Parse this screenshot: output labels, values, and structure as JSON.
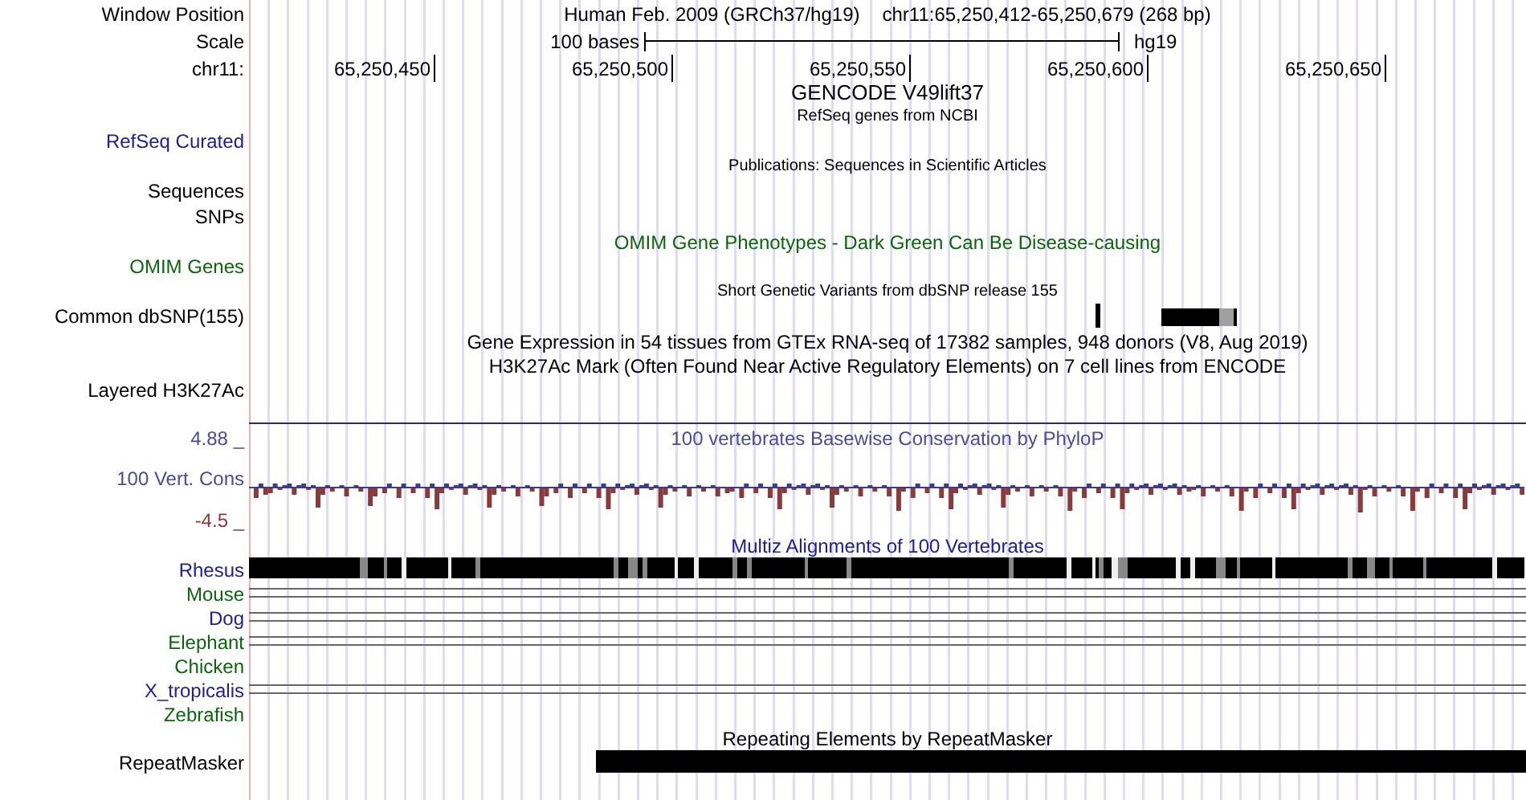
{
  "header": {
    "window_label": "Window Position",
    "scale_label": "Scale",
    "chrom_label": "chr11:",
    "title": "Human Feb. 2009 (GRCh37/hg19)",
    "position": "chr11:65,250,412-65,250,679 (268 bp)",
    "scale_text": "100 bases",
    "scale_db": "hg19",
    "ticks": [
      "65,250,450",
      "65,250,500",
      "65,250,550",
      "65,250,600",
      "65,250,650"
    ]
  },
  "tracks": [
    {
      "kind": "title",
      "title": "GENCODE V49lift37",
      "color": "#000000"
    },
    {
      "kind": "label",
      "title": "RefSeq genes from NCBI",
      "color": "#000000",
      "labels": [
        {
          "text": "RefSeq Curated",
          "color": "#20208f"
        }
      ]
    },
    {
      "kind": "label",
      "title": "Publications: Sequences in Scientific Articles",
      "color": "#000000",
      "labels": [
        {
          "text": "Sequences",
          "color": "#000000"
        },
        {
          "text": "SNPs",
          "color": "#000000"
        }
      ]
    },
    {
      "kind": "label",
      "title": "OMIM Gene Phenotypes - Dark Green Can Be Disease-causing",
      "color": "#0b650b",
      "labels": [
        {
          "text": "OMIM Genes",
          "color": "#0b650b"
        }
      ]
    },
    {
      "kind": "snp",
      "title": "Short Genetic Variants from dbSNP release 155",
      "color": "#000000",
      "labels": [
        {
          "text": "Common dbSNP(155)",
          "color": "#000000"
        }
      ]
    },
    {
      "kind": "title",
      "title": "Gene Expression in 54 tissues from GTEx RNA-seq of 17382 samples, 948 donors (V8, Aug 2019)",
      "color": "#000000"
    },
    {
      "kind": "layered",
      "title": "H3K27Ac Mark (Often Found Near Active Regulatory Elements) on 7 cell lines from ENCODE",
      "color": "#000000",
      "labels": [
        {
          "text": "Layered H3K27Ac",
          "color": "#000000"
        }
      ]
    },
    {
      "kind": "wiggle",
      "title": "100 vertebrates Basewise Conservation by PhyloP",
      "color": "#4a4a9a",
      "labels": [
        {
          "text": "4.88 _",
          "color": "#4a4a9a"
        },
        {
          "text": "100 Vert. Cons",
          "color": "#4a4a9a"
        },
        {
          "text": "-4.5 _",
          "color": "#8b3a3a"
        }
      ]
    },
    {
      "kind": "multiz",
      "title": "Multiz Alignments of 100 Vertebrates",
      "color": "#20208f",
      "species": [
        {
          "name": "Rhesus",
          "color": "#20208f",
          "kind": "block"
        },
        {
          "name": "Mouse",
          "color": "#0b650b",
          "kind": "lines"
        },
        {
          "name": "Dog",
          "color": "#20208f",
          "kind": "lines"
        },
        {
          "name": "Elephant",
          "color": "#0b650b",
          "kind": "lines"
        },
        {
          "name": "Chicken",
          "color": "#0b650b",
          "kind": "none"
        },
        {
          "name": "X_tropicalis",
          "color": "#20208f",
          "kind": "lines"
        },
        {
          "name": "Zebrafish",
          "color": "#0b650b",
          "kind": "none"
        }
      ]
    },
    {
      "kind": "repeat",
      "title": "Repeating Elements by RepeatMasker",
      "color": "#000000",
      "labels": [
        {
          "text": "RepeatMasker",
          "color": "#000000"
        }
      ]
    }
  ]
}
